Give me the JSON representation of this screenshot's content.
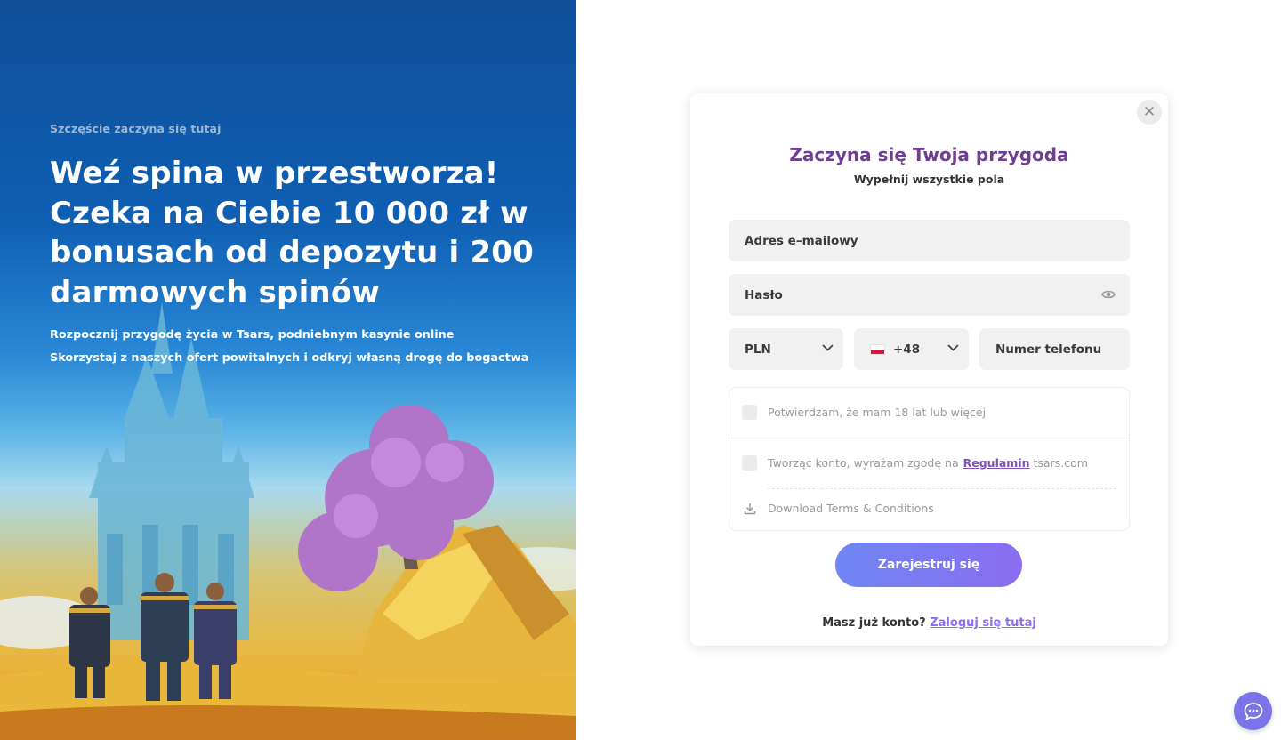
{
  "hero": {
    "kicker": "Szczęście zaczyna się tutaj",
    "title": "Weź spina w przestworza! Czeka na Ciebie 10 000 zł w bonusach od depozytu i 200 darmowych spinów",
    "subtitle_1": "Rozpocznij przygodę życia w Tsars, podniebnym kasynie online",
    "subtitle_2": "Skorzystaj z naszych ofert powitalnych i odkryj własną drogę do bogactwa"
  },
  "modal": {
    "close_icon": "close-icon",
    "title": "Zaczyna się Twoja przygoda",
    "subtitle": "Wypełnij wszystkie pola",
    "email_placeholder": "Adres e–mailowy",
    "password_placeholder": "Hasło",
    "currency_value": "PLN",
    "country_code": "+48",
    "phone_placeholder": "Numer telefonu",
    "age_consent": "Potwierdzam, że mam 18 lat lub więcej",
    "terms_prefix": "Tworząc konto, wyrażam zgodę na",
    "terms_link": "Regulamin",
    "terms_suffix": "tsars.com",
    "download_terms": "Download Terms & Conditions",
    "submit_label": "Zarejestruj się",
    "login_prompt": "Masz już konto?",
    "login_link": "Zaloguj się tutaj"
  },
  "colors": {
    "accent": "#6f3d91",
    "button_start": "#6e86f3",
    "button_end": "#8b6df0",
    "link": "#8b6df0"
  },
  "icons": {
    "eye": "eye-icon",
    "chevron": "chevron-down-icon",
    "download": "download-icon",
    "chat": "chat-icon",
    "flag": "poland-flag-icon"
  }
}
